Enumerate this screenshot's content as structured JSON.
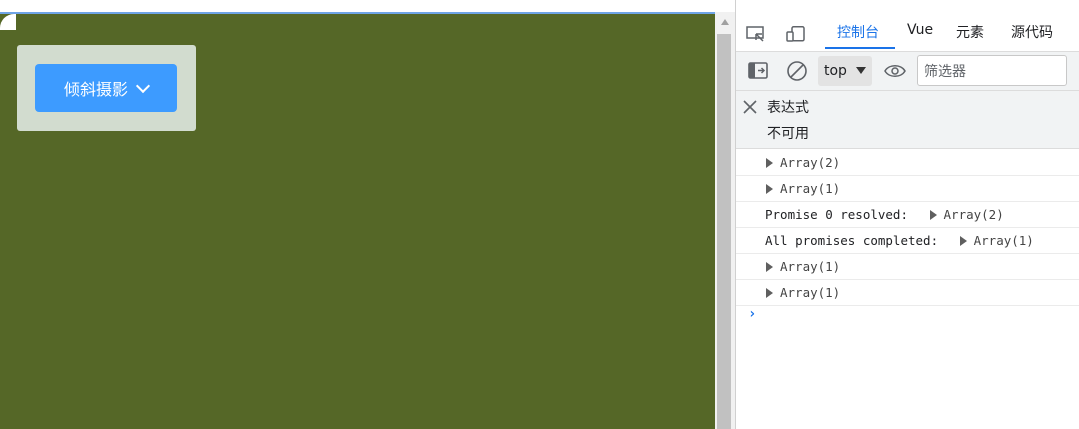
{
  "app": {
    "dropdown_button_label": "倾斜摄影"
  },
  "devtools": {
    "tabs": [
      {
        "label": "控制台",
        "active": true
      },
      {
        "label": "Vue",
        "active": false
      },
      {
        "label": "元素",
        "active": false
      },
      {
        "label": "源代码",
        "active": false
      }
    ],
    "toolbar": {
      "context": "top",
      "filter_placeholder": "筛选器"
    },
    "expression": {
      "label": "表达式",
      "value": "不可用"
    },
    "console_rows": [
      {
        "prefix": "",
        "object": "Array(2)"
      },
      {
        "prefix": "",
        "object": "Array(1)"
      },
      {
        "prefix": "Promise 0 resolved:",
        "object": "Array(2)"
      },
      {
        "prefix": "All promises completed:",
        "object": "Array(1)"
      },
      {
        "prefix": "",
        "object": "Array(1)"
      },
      {
        "prefix": "",
        "object": "Array(1)"
      }
    ],
    "prompt_symbol": "›"
  },
  "colors": {
    "app_background": "#556727",
    "primary_button": "#3d9bff",
    "active_tab": "#1a73e8"
  }
}
